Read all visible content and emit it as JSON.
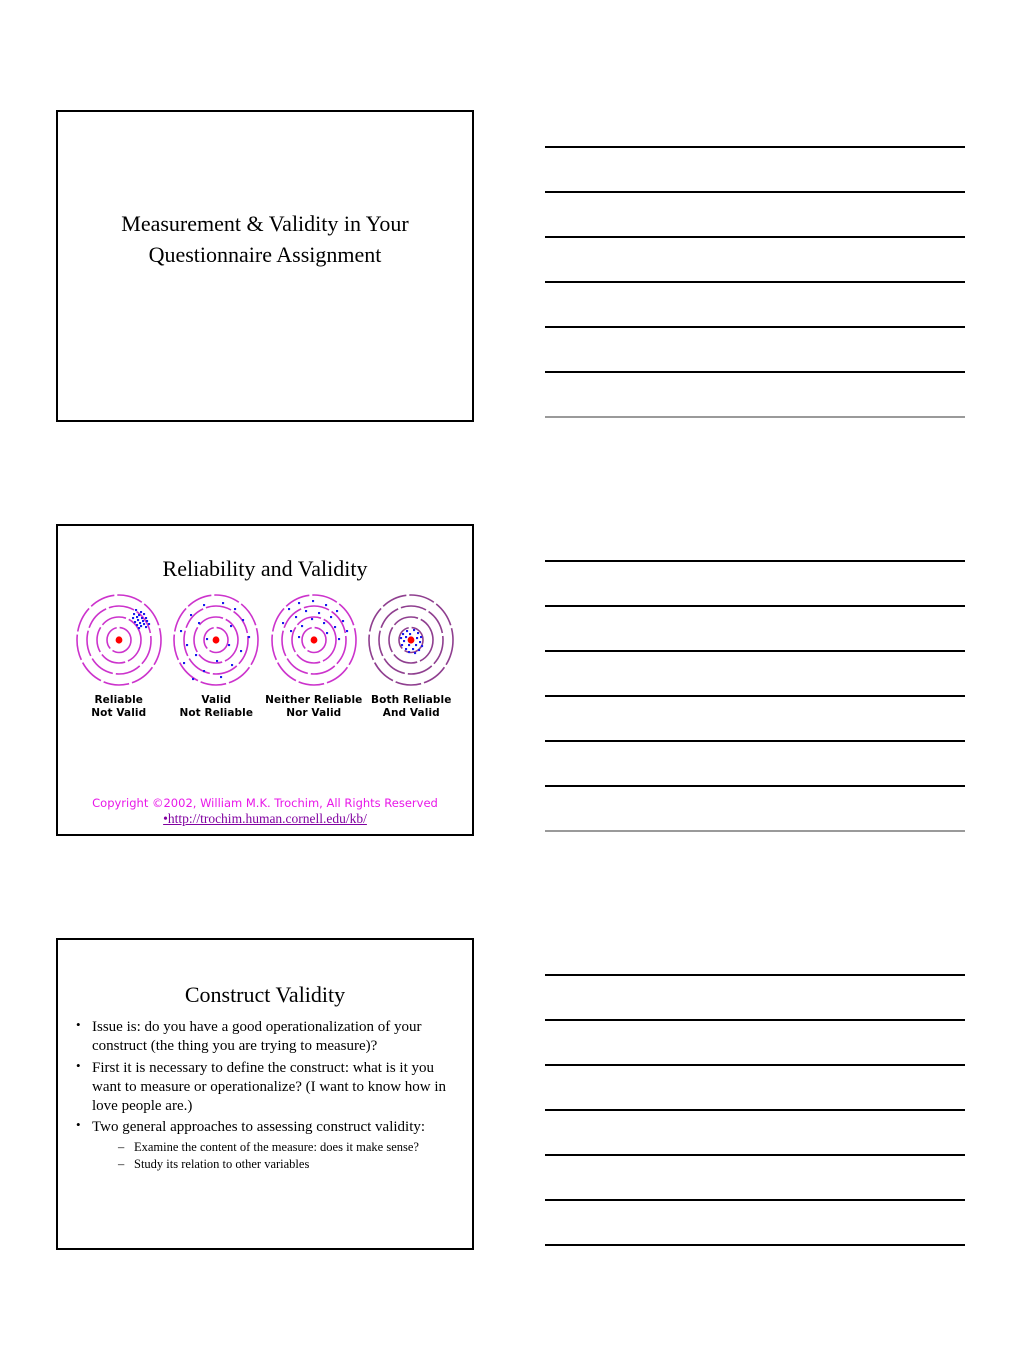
{
  "slides": [
    {
      "id": "title-slide",
      "title_lines": [
        "Measurement & Validity in Your",
        "Questionnaire Assignment"
      ]
    },
    {
      "id": "reliability-validity-slide",
      "heading": "Reliability and Validity",
      "targets": [
        {
          "caption_lines": [
            "Reliable",
            "Not Valid"
          ],
          "pattern": "tight-cluster-offcenter"
        },
        {
          "caption_lines": [
            "Valid",
            "Not Reliable"
          ],
          "pattern": "scattered-around-center"
        },
        {
          "caption_lines": [
            "Neither Reliable",
            "Nor Valid"
          ],
          "pattern": "scattered-offcenter"
        },
        {
          "caption_lines": [
            "Both Reliable",
            "And Valid"
          ],
          "pattern": "tight-cluster-center"
        }
      ],
      "credit": "Copyright ©2002, William M.K. Trochim, All Rights Reserved",
      "credit_url": "•http://trochim.human.cornell.edu/kb/",
      "colors": {
        "ring": "#cc33cc",
        "bullseye": "#ff0000",
        "dot": "#1a1aee",
        "credit": "#e818e8",
        "url": "#8000a0"
      }
    },
    {
      "id": "construct-validity-slide",
      "heading": "Construct Validity",
      "bullets": [
        {
          "text": "Issue is: do you have a good operationalization of your construct (the thing you are trying to measure)?"
        },
        {
          "text": "First it is necessary to define the construct: what is it you want to measure or operationalize?  (I want to know how in love people are.)"
        },
        {
          "text": "Two general approaches to assessing construct validity:",
          "sub_items": [
            "Examine the content of the measure: does it make sense?",
            "Study its relation to other variables"
          ]
        }
      ]
    }
  ],
  "notes_groups": [
    {
      "lines": [
        "dark",
        "dark",
        "dark",
        "dark",
        "dark",
        "dark",
        "faint"
      ]
    },
    {
      "lines": [
        "dark",
        "dark",
        "dark",
        "dark",
        "dark",
        "dark",
        "faint"
      ]
    },
    {
      "lines": [
        "dark",
        "dark",
        "dark",
        "dark",
        "dark",
        "dark",
        "dark"
      ]
    }
  ]
}
